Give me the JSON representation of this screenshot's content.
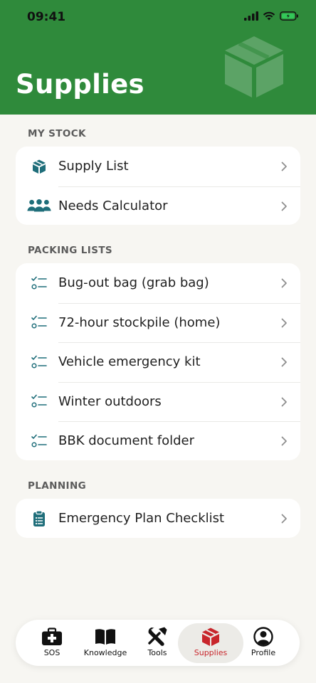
{
  "status": {
    "time": "09:41"
  },
  "header": {
    "title": "Supplies"
  },
  "sections": {
    "my_stock": {
      "label": "MY STOCK",
      "items": [
        {
          "label": "Supply List",
          "icon": "box-icon"
        },
        {
          "label": "Needs Calculator",
          "icon": "people-icon"
        }
      ]
    },
    "packing_lists": {
      "label": "PACKING LISTS",
      "items": [
        {
          "label": "Bug-out bag (grab bag)",
          "icon": "checklist-icon"
        },
        {
          "label": "72-hour stockpile (home)",
          "icon": "checklist-icon"
        },
        {
          "label": "Vehicle emergency kit",
          "icon": "checklist-icon"
        },
        {
          "label": "Winter outdoors",
          "icon": "checklist-icon"
        },
        {
          "label": "BBK document folder",
          "icon": "checklist-icon"
        }
      ]
    },
    "planning": {
      "label": "PLANNING",
      "items": [
        {
          "label": "Emergency Plan Checklist",
          "icon": "clipboard-icon"
        }
      ]
    }
  },
  "tabbar": {
    "tabs": [
      {
        "label": "SOS",
        "icon": "first-aid-kit-icon"
      },
      {
        "label": "Knowledge",
        "icon": "book-icon"
      },
      {
        "label": "Tools",
        "icon": "tools-icon"
      },
      {
        "label": "Supplies",
        "icon": "box-icon",
        "active": true
      },
      {
        "label": "Profile",
        "icon": "profile-icon"
      }
    ]
  },
  "colors": {
    "header_green": "#2f8a3b",
    "icon_teal": "#1f6e7a",
    "active_red": "#c8262c",
    "background": "#f7f6f2"
  }
}
